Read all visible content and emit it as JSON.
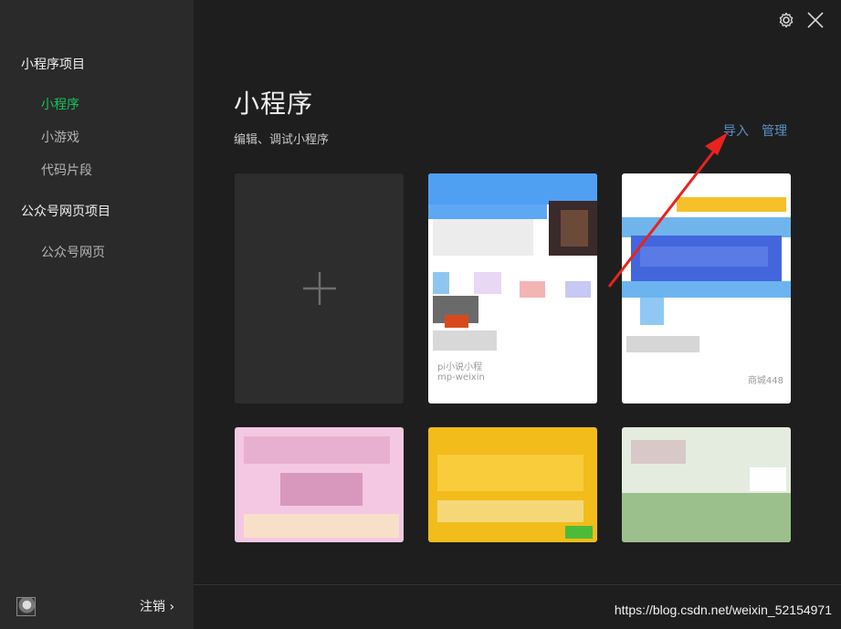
{
  "sidebar": {
    "section_mini": "小程序项目",
    "items_mini": [
      "小程序",
      "小游戏",
      "代码片段"
    ],
    "section_web": "公众号网页项目",
    "items_web": [
      "公众号网页"
    ],
    "logout_label": "注销 ›"
  },
  "window": {
    "settings_icon": "gear-icon",
    "close_icon": "close-icon"
  },
  "main": {
    "title": "小程序",
    "subtitle": "编辑、调试小程序",
    "import_label": "导入",
    "manage_label": "管理",
    "new_project_icon": "plus-icon"
  },
  "projects": [
    {
      "caption1": "pi小说小程",
      "caption2": "mp-weixin"
    },
    {
      "caption1": "商城448"
    }
  ],
  "watermark": "https://blog.csdn.net/weixin_52154971",
  "colors": {
    "active": "#17c35c",
    "link": "#5a8fc8",
    "arrow": "#e8231e"
  }
}
